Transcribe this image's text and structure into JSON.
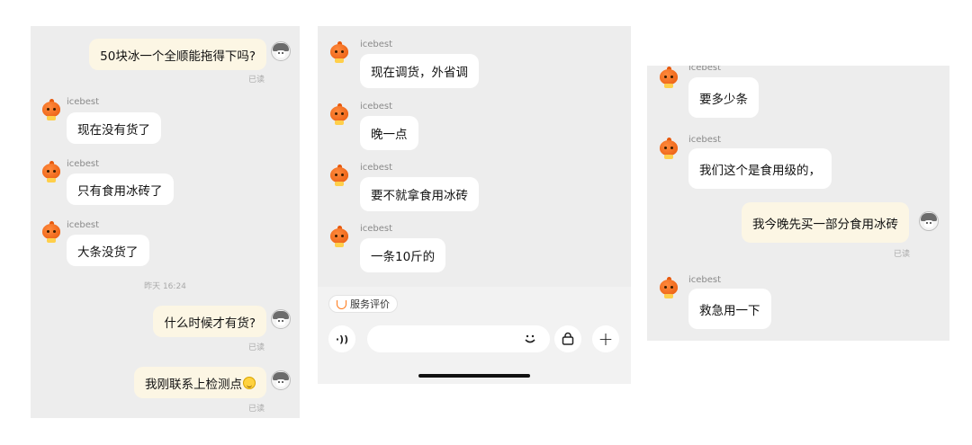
{
  "panel1": {
    "m1": {
      "text": "50块冰一个全顺能拖得下吗?",
      "read": "已读"
    },
    "m2": {
      "name": "icebest",
      "text": "现在没有货了"
    },
    "m3": {
      "name": "icebest",
      "text": "只有食用冰砖了"
    },
    "m4": {
      "name": "icebest",
      "text": "大条没货了"
    },
    "timestamp": "昨天 16:24",
    "m5": {
      "text": "什么时候才有货?",
      "read": "已读"
    },
    "m6": {
      "text": "我刚联系上检测点",
      "emoji": "smiling-face-emoji",
      "read": "已读"
    }
  },
  "panel2": {
    "m1": {
      "name": "icebest",
      "text": "现在调货，外省调"
    },
    "m2": {
      "name": "icebest",
      "text": "晚一点"
    },
    "m3": {
      "name": "icebest",
      "text": "要不就拿食用冰砖"
    },
    "m4": {
      "name": "icebest",
      "text": "一条10斤的"
    },
    "service_chip": "服务评价",
    "icons": {
      "voice": "voice-icon",
      "emoji": "emoji-icon",
      "bag": "shopping-bag-icon",
      "plus": "plus-icon"
    },
    "glyphs": {
      "voice": "·))",
      "plus": "+"
    }
  },
  "panel3": {
    "m1": {
      "name": "icebest",
      "text": "要多少条"
    },
    "m2": {
      "name": "icebest",
      "text": "我们这个是食用级的，"
    },
    "m3": {
      "text": "我今晚先买一部分食用冰砖",
      "read": "已读"
    },
    "m4": {
      "name": "icebest",
      "text": "救急用一下"
    }
  },
  "colors": {
    "panel_bg": "#ededed",
    "my_bubble": "#fcf6e4",
    "their_bubble": "#ffffff",
    "accent_orange": "#e8590c"
  }
}
